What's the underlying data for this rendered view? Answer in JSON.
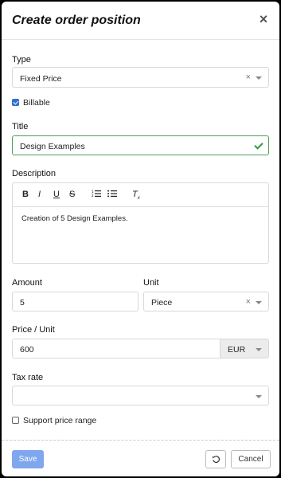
{
  "dialog": {
    "title": "Create order position",
    "close_icon": "close-icon"
  },
  "type": {
    "label": "Type",
    "value": "Fixed Price"
  },
  "billable": {
    "label": "Billable",
    "checked": true
  },
  "title_field": {
    "label": "Title",
    "value": "Design Examples",
    "valid": true
  },
  "description": {
    "label": "Description",
    "toolbar": {
      "bold": "B",
      "italic": "I",
      "underline": "U",
      "strike": "S",
      "ordered_list_icon": "ordered-list-icon",
      "bullet_list_icon": "bullet-list-icon",
      "clear_format": "T"
    },
    "content": "Creation of 5 Design Examples."
  },
  "amount": {
    "label": "Amount",
    "value": "5"
  },
  "unit": {
    "label": "Unit",
    "value": "Piece"
  },
  "price_unit": {
    "label": "Price / Unit",
    "value": "600",
    "currency": "EUR"
  },
  "tax_rate": {
    "label": "Tax rate",
    "value": ""
  },
  "price_range": {
    "label": "Support price range",
    "checked": false
  },
  "footer": {
    "save_label": "Save",
    "reset_icon": "reset-icon",
    "cancel_label": "Cancel"
  },
  "colors": {
    "accent": "#2f6fd6",
    "valid": "#2e9a3e",
    "save_disabled": "#7ea7ee"
  }
}
